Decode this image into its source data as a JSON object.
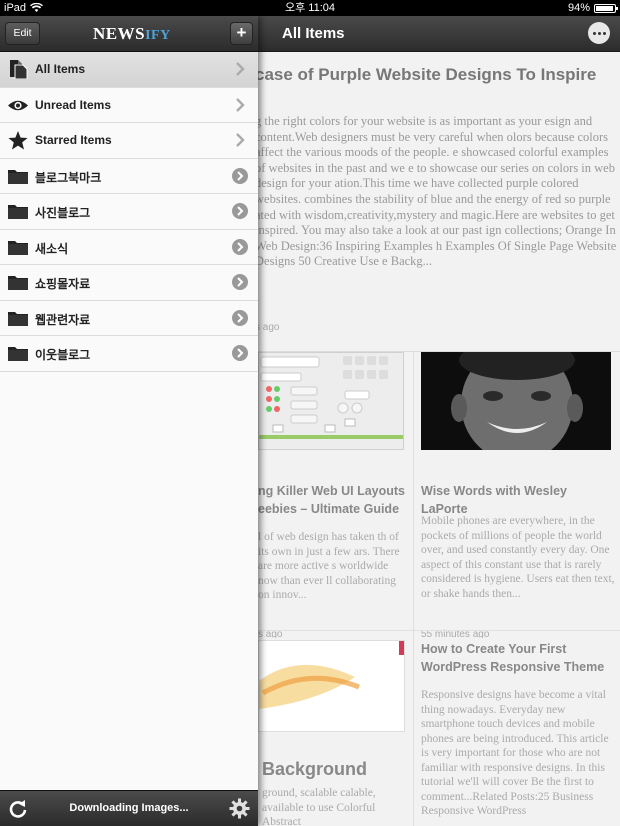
{
  "status_bar": {
    "device": "iPad",
    "time": "오후 11:04",
    "battery": "94%",
    "battery_level": 0.94
  },
  "header": {
    "title": "All Items"
  },
  "sidebar": {
    "edit_label": "Edit",
    "logo_main": "NEWS",
    "logo_accent": "IFY",
    "add_label": "+",
    "items": [
      {
        "label": "All Items",
        "icon": "document-icon",
        "accessory": "chevron"
      },
      {
        "label": "Unread Items",
        "icon": "eye-icon",
        "accessory": "chevron"
      },
      {
        "label": "Starred Items",
        "icon": "star-icon",
        "accessory": "chevron"
      },
      {
        "label": "블로그북마크",
        "icon": "folder-icon",
        "accessory": "disclosure"
      },
      {
        "label": "사진블로그",
        "icon": "folder-icon",
        "accessory": "disclosure"
      },
      {
        "label": "새소식",
        "icon": "folder-icon",
        "accessory": "disclosure"
      },
      {
        "label": "쇼핑몰자료",
        "icon": "folder-icon",
        "accessory": "disclosure"
      },
      {
        "label": "웹관련자료",
        "icon": "folder-icon",
        "accessory": "disclosure"
      },
      {
        "label": "이웃블로그",
        "icon": "folder-icon",
        "accessory": "disclosure"
      }
    ],
    "footer_status": "Downloading Images..."
  },
  "articles": {
    "featured": {
      "title": "case of Purple Website Designs To Inspire",
      "body": "g the right colors for your website is as important as your esign and content.Web designers must be very careful when olors because colors affect the various moods of the people. e showcased colorful examples of websites in the past and we e to showcase our series on colors in web design for your ation.This time we have collected purple colored websites. combines the stability of blue and the energy of red so purple ated with wisdom,creativity,mystery and magic.Here are websites to get inspired. You may also take a look at our past ign collections;  Orange In Web Design:36 Inspiring Examples h Examples Of Single Page Website Designs  50 Creative Use e Backg...",
      "time": "s ago"
    },
    "card_left": {
      "title": "ng Killer Web UI Layouts eebies – Ultimate Guide",
      "body": "l of web design has taken th of its own in just a few ars. There are more active s worldwide now than ever ll collaborating on innov...",
      "time": "s ago"
    },
    "card_right": {
      "title": "Wise Words with Wesley LaPorte",
      "body": "Mobile phones are everywhere, in the pockets of millions of people the world over, and used constantly every day. One aspect of this constant use that is rarely considered is hygiene. Users eat then text, or shake hands then...",
      "time": "55 minutes ago"
    },
    "card_bottom_left": {
      "title": "Background",
      "body": "ground, scalable calable, available to use Colorful Abstract"
    },
    "card_bottom_right": {
      "title": "How to Create Your First WordPress Responsive Theme",
      "body": "Responsive designs have become a vital thing nowadays. Everyday new smartphone touch devices and mobile phones are being introduced. This article is very important for those who are not familiar with responsive designs. In this tutorial we'll will cover Be the first to comment...Related Posts:25 Business Responsive WordPress"
    }
  },
  "colors": {
    "header_dark": "#2c2c2c",
    "logo_accent": "#4fa3d8",
    "accessory_gray": "#999999"
  }
}
